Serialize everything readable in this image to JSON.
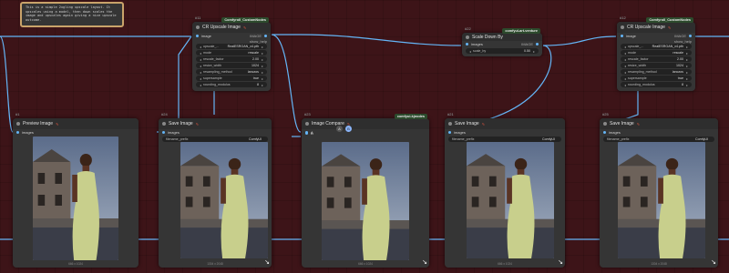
{
  "note": {
    "text": "This is a simple 2xgling upscale layout. It upscales using a model, then down scales the image and upscales again giving a nice upscale outcome."
  },
  "nodes": {
    "ca": {
      "id": "#11",
      "badge": "Comfyroll_CustomNodes",
      "title": "CR Upscale Image",
      "in_image": "image",
      "out_image": "IMAGE",
      "out_help": "show_help",
      "widgets": [
        {
          "label": "upscale_...",
          "value": "RealESRGAN_x4.pth"
        },
        {
          "label": "mode",
          "value": "rescale"
        },
        {
          "label": "rescale_factor",
          "value": "2.00"
        },
        {
          "label": "resize_width",
          "value": "1024"
        },
        {
          "label": "resampling_method",
          "value": "lanczos"
        },
        {
          "label": "supersample",
          "value": "true"
        },
        {
          "label": "rounding_modulus",
          "value": "8"
        }
      ]
    },
    "scale": {
      "id": "#22",
      "badge": "comfyui-art-venture",
      "title": "Scale Down By",
      "in_image": "images",
      "out_image": "IMAGE",
      "widgets": [
        {
          "label": "scale_by",
          "value": "0.50"
        }
      ]
    },
    "cr2": {
      "id": "#12",
      "badge": "Comfyroll_CustomNodes",
      "title": "CR Upscale Image",
      "in_image": "image",
      "out_image": "IMAGE",
      "out_help": "show_help",
      "widgets": [
        {
          "label": "upscale_...",
          "value": "RealESRGAN_x4.pth"
        },
        {
          "label": "mode",
          "value": "rescale"
        },
        {
          "label": "rescale_factor",
          "value": "2.00"
        },
        {
          "label": "resize_width",
          "value": "1024"
        },
        {
          "label": "resampling_method",
          "value": "lanczos"
        },
        {
          "label": "supersample",
          "value": "true"
        },
        {
          "label": "rounding_modulus",
          "value": "8"
        }
      ]
    },
    "preview": {
      "id": "#1",
      "title": "Preview Image",
      "in_image": "images",
      "foot": "666 x 1024"
    },
    "save1": {
      "id": "#24",
      "title": "Save Image",
      "in_image": "images",
      "prefix_label": "filename_prefix",
      "prefix_value": "ComfyUI",
      "foot": "1304 x 2048"
    },
    "compare": {
      "id": "#23",
      "badge": "comfyui-kjnodes",
      "title": "Image Compare",
      "in_a": "A",
      "in_b": "B",
      "btn1": "A",
      "btn2": "B",
      "foot": "666 x 1024"
    },
    "save2": {
      "id": "#21",
      "title": "Save Image",
      "in_image": "images",
      "prefix_label": "filename_prefix",
      "prefix_value": "ComfyUI",
      "foot": "666 x 1024"
    },
    "save3": {
      "id": "#25",
      "title": "Save Image",
      "in_image": "images",
      "prefix_label": "filename_prefix",
      "prefix_value": "ComfyUI",
      "foot": "1304 x 2048"
    }
  },
  "colors": {
    "canvas": "#3d1418",
    "wire": "#64b5f6",
    "node": "#353535"
  }
}
